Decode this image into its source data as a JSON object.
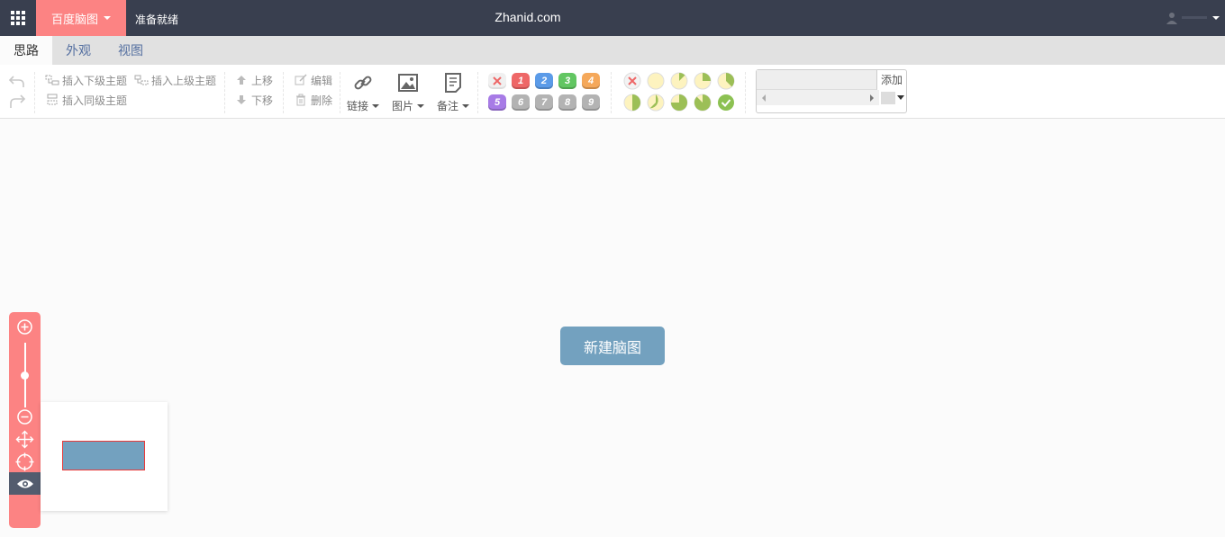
{
  "app": {
    "brand_label": "百度脑图",
    "status": "准备就绪",
    "site_title": "Zhanid.com"
  },
  "tabs": [
    {
      "label": "思路",
      "active": true
    },
    {
      "label": "外观",
      "active": false
    },
    {
      "label": "视图",
      "active": false
    }
  ],
  "toolbar": {
    "insert_child": "插入下级主题",
    "insert_parent": "插入上级主题",
    "insert_sibling": "插入同级主题",
    "move_up": "上移",
    "move_down": "下移",
    "edit": "编辑",
    "delete": "删除",
    "link": "链接",
    "image": "图片",
    "note": "备注",
    "priorities": [
      "1",
      "2",
      "3",
      "4",
      "5",
      "6",
      "7",
      "8",
      "9"
    ],
    "resource_add": "添加"
  },
  "colors": {
    "topbar": "#393f4f",
    "accent": "#fc8383",
    "node": "#73a1bf",
    "priority": [
      "#ee6767",
      "#5b9be8",
      "#62c662",
      "#f5a85a",
      "#a77be6",
      "#b3b3b3",
      "#b3b3b3",
      "#b3b3b3",
      "#b3b3b3"
    ]
  },
  "canvas": {
    "root_label": "新建脑图"
  }
}
